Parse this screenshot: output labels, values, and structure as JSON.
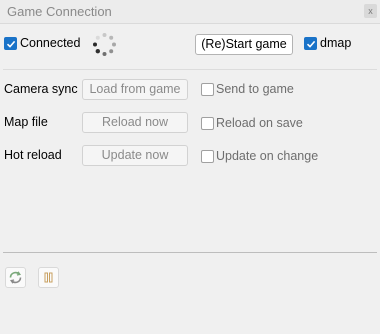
{
  "window": {
    "title": "Game Connection",
    "close_glyph": "x"
  },
  "header": {
    "connected_label": "Connected",
    "connected_checked": true,
    "restart_label": "(Re)Start game",
    "dmap_label": "dmap",
    "dmap_checked": true
  },
  "rows": [
    {
      "label": "Camera sync",
      "button": "Load from game",
      "check_label": "Send to game",
      "checked": false
    },
    {
      "label": "Map file",
      "button": "Reload now",
      "check_label": "Reload on save",
      "checked": false
    },
    {
      "label": "Hot reload",
      "button": "Update now",
      "check_label": "Update on change",
      "checked": false
    }
  ],
  "footer": {
    "tools": [
      {
        "icon": "refresh-icon"
      },
      {
        "icon": "pause-icon"
      }
    ]
  },
  "colors": {
    "accent": "#1a73c8",
    "background": "#f0f0f0"
  }
}
